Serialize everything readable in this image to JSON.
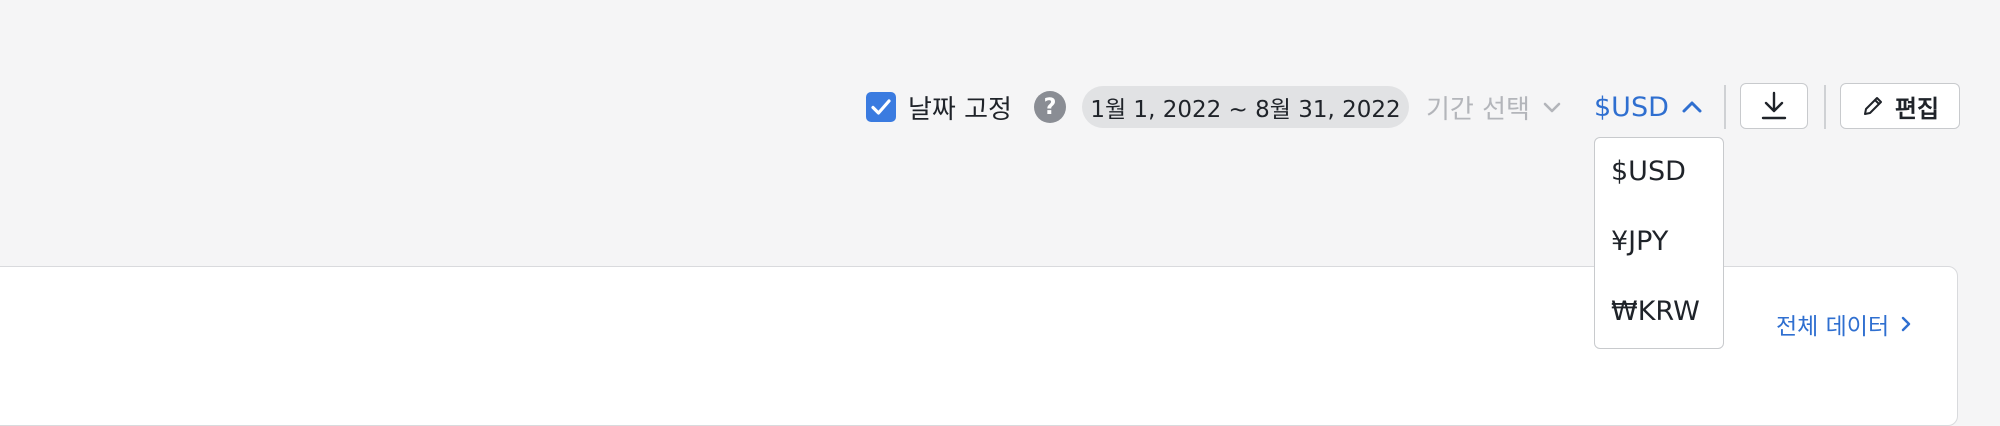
{
  "toolbar": {
    "fix_date_label": "날짜 고정",
    "fix_date_checked": true,
    "help_symbol": "?",
    "date_range": "1월 1, 2022 ~ 8월 31, 2022",
    "period_select_label": "기간 선택",
    "currency_selected": "$USD",
    "edit_label": "편집"
  },
  "currency_dropdown": {
    "options": [
      "$USD",
      "¥JPY",
      "₩KRW"
    ]
  },
  "panel": {
    "all_data_link": "전체 데이터"
  },
  "icons": {
    "checkbox": "checkmark-icon",
    "help": "question-icon",
    "period": "chevron-down-icon",
    "currency": "chevron-up-icon",
    "download": "download-icon",
    "edit": "pencil-icon",
    "all_data": "chevron-right-icon"
  },
  "colors": {
    "accent": "#2f6fd0",
    "checkbox": "#3a7be0",
    "background": "#f5f5f6",
    "pill": "#e1e2e4",
    "muted_text": "#b3b5ba"
  }
}
